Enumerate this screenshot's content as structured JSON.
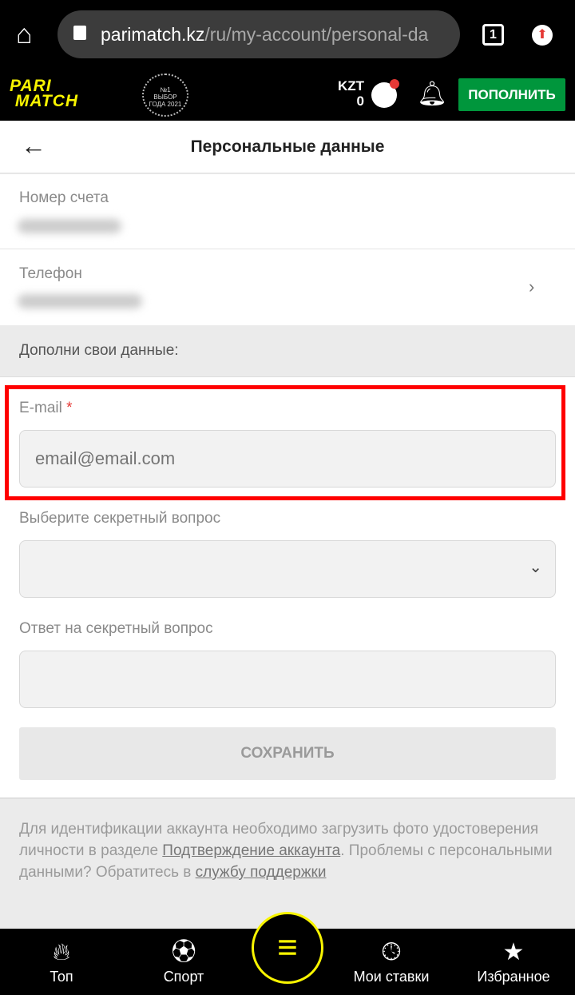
{
  "browser": {
    "url_host": "parimatch.kz",
    "url_path": "/ru/my-account/personal-da",
    "tab_count": "1"
  },
  "header": {
    "logo": "PARI MATCH",
    "badge": "№1 ВЫБОР ГОДА 2021",
    "currency": "KZT",
    "balance": "0",
    "topup_label": "ПОПОЛНИТЬ",
    "accent": "#00963c",
    "brand": "#f8f400"
  },
  "page": {
    "title": "Персональные данные"
  },
  "account": {
    "number_label": "Номер счета",
    "phone_label": "Телефон"
  },
  "section": {
    "complete_label": "Дополни свои данные:"
  },
  "form": {
    "email_label": "E-mail",
    "required_mark": "*",
    "email_placeholder": "email@email.com",
    "question_label": "Выберите секретный вопрос",
    "answer_label": "Ответ на секретный вопрос",
    "save_label": "СОХРАНИТЬ"
  },
  "footer": {
    "text1": "Для идентификации аккаунта необходимо загрузить фото удостоверения личности в разделе ",
    "link1": "Подтверждение аккаунта",
    "text2": ". Проблемы с персональными данными? Обратитесь в ",
    "link2": "службу поддержки"
  },
  "nav": {
    "items": [
      {
        "label": "Топ",
        "icon": "flame-icon"
      },
      {
        "label": "Спорт",
        "icon": "soccer-ball-icon"
      },
      {
        "label": "Мои ставки",
        "icon": "clock-icon"
      },
      {
        "label": "Избранное",
        "icon": "star-icon"
      }
    ]
  }
}
